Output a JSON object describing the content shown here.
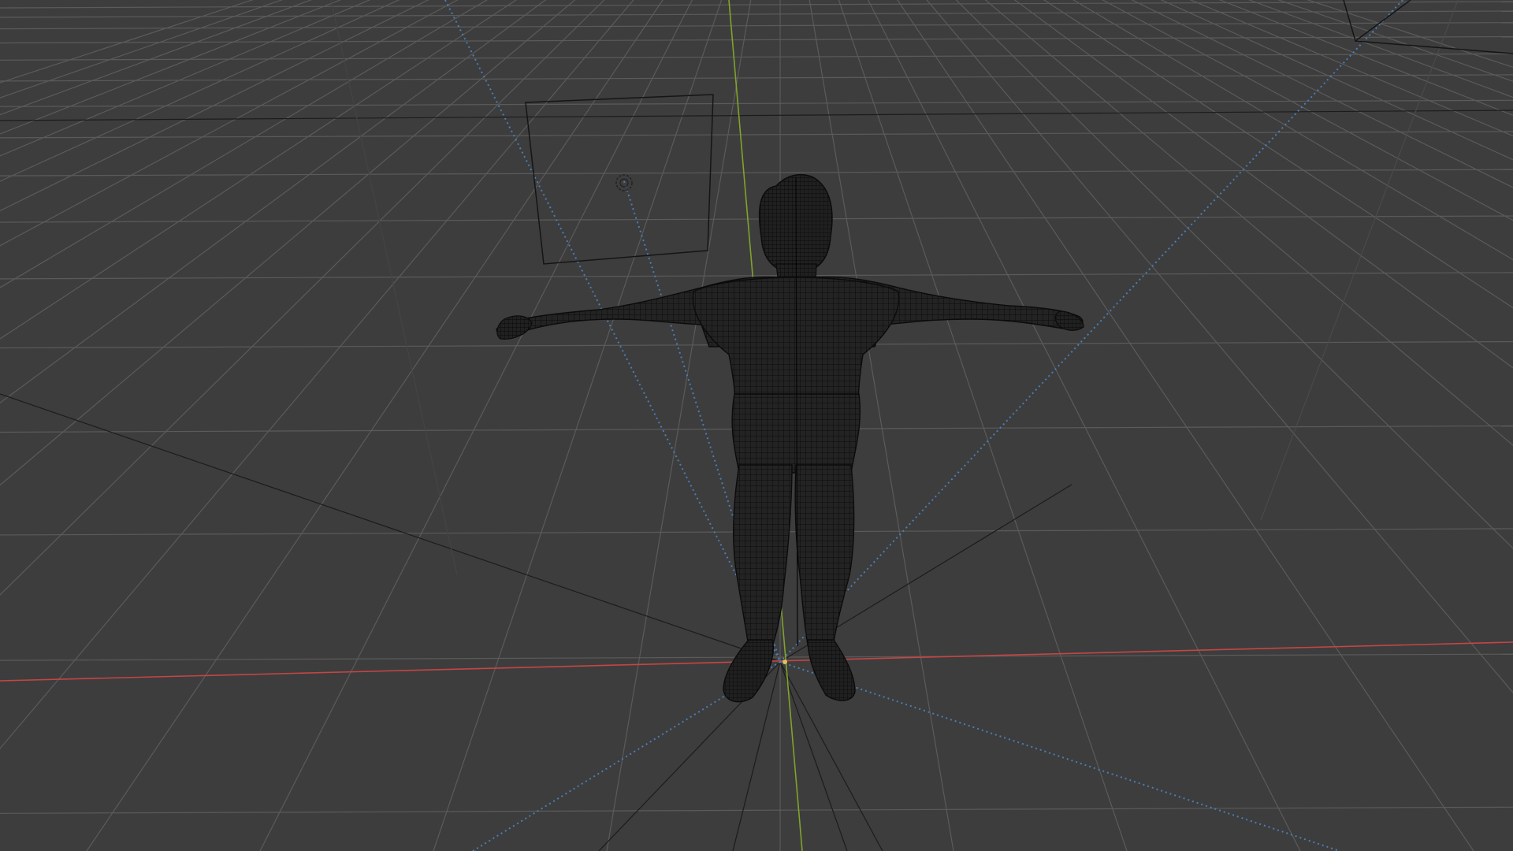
{
  "viewport": {
    "background": "#3d3d3d",
    "grid_color": "#5a5a5a",
    "x_axis_color": "#c94a4a",
    "y_axis_color": "#7fa32b",
    "mesh_color": "#0e0e0e",
    "mesh_fill": "#262626",
    "light_ray_color": "#4a78b0",
    "object_outline_color": "#1a1a1a"
  },
  "icons": {
    "mesh": "wireframe-human-mesh-icon",
    "light": "point-light-icon",
    "camera": "camera-frame-icon"
  }
}
